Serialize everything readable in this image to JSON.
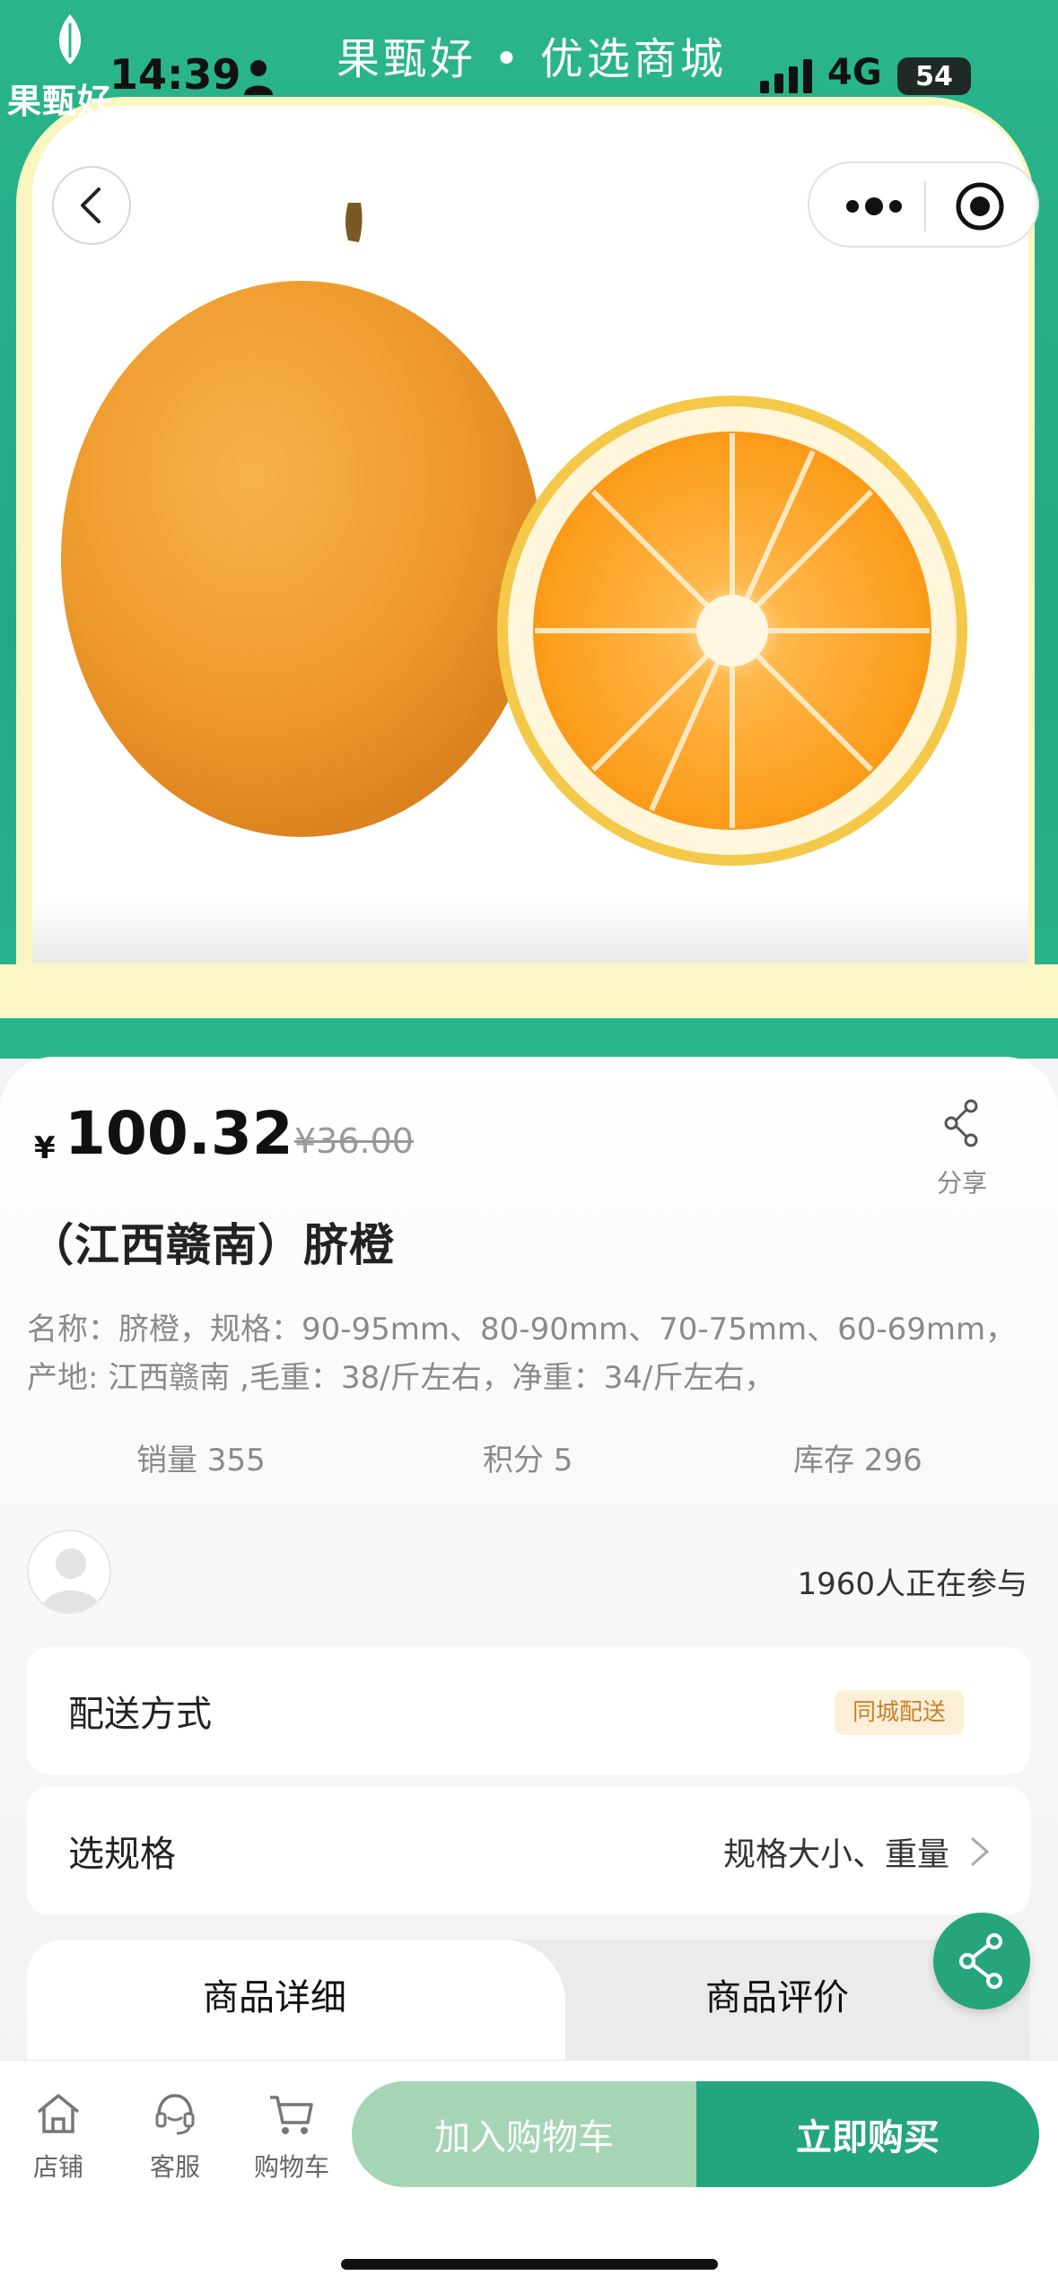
{
  "header": {
    "brand_name": "果甄好",
    "title": "果甄好 • 优选商城",
    "brand_color": "#2ab58c"
  },
  "status_bar": {
    "time": "14:39",
    "network": "4G",
    "battery": "54"
  },
  "controls": {
    "back_icon": "chevron-left-icon",
    "more_icon": "more-dots-icon",
    "close_icon": "target-icon"
  },
  "product": {
    "currency": "¥",
    "price": "100.32",
    "original_price": "¥36.00",
    "share_label": "分享",
    "title": "（江西赣南）脐橙",
    "description": "名称：脐橙，规格：90-95mm、80-90mm、70-75mm、60-69mm，产地: 江西赣南 ,毛重：38/斤左右，净重：34/斤左右，",
    "stats": {
      "sales": "销量 355",
      "points": "积分 5",
      "stock": "库存 296"
    },
    "participants": "1960人正在参与"
  },
  "delivery": {
    "label": "配送方式",
    "tag": "同城配送"
  },
  "spec": {
    "label": "选规格",
    "value": "规格大小、重量"
  },
  "tabs": [
    {
      "label": "商品详细",
      "active": true
    },
    {
      "label": "商品评价",
      "active": false
    }
  ],
  "bottom_nav": {
    "store": "店铺",
    "service": "客服",
    "cart": "购物车",
    "add_to_cart": "加入购物车",
    "buy_now": "立即购买"
  },
  "colors": {
    "accent": "#23a57d",
    "accent_light": "#a6d5b6",
    "tag_bg": "#fcefd8",
    "tag_text": "#c9822c"
  }
}
